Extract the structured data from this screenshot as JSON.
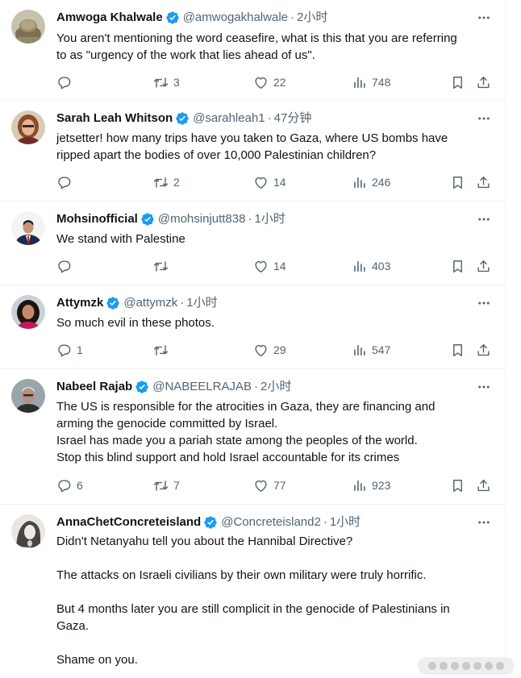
{
  "colors": {
    "text": "#0f1419",
    "muted": "#536471",
    "verified": "#1d9bf0",
    "border": "#eff3f4"
  },
  "icons": {
    "verified": "verified-badge-icon",
    "more": "more-horizontal-icon",
    "reply": "reply-icon",
    "retweet": "retweet-icon",
    "like": "heart-icon",
    "views": "views-chart-icon",
    "bookmark": "bookmark-icon",
    "share": "share-icon"
  },
  "tweets": [
    {
      "name": "Amwoga Khalwale",
      "handle": "@amwogakhalwale",
      "sep": "·",
      "time": "2小时",
      "lines": [
        "You aren't mentioning the word ceasefire, what is this that you are referring",
        "to as \"urgency of the work that lies ahead of us\"."
      ],
      "replies": "",
      "retweets": "3",
      "likes": "22",
      "views": "748"
    },
    {
      "name": "Sarah Leah Whitson",
      "handle": "@sarahleah1",
      "sep": "·",
      "time": "47分钟",
      "lines": [
        "jetsetter! how many trips have you taken to Gaza, where US bombs have",
        "ripped apart the bodies of over 10,000 Palestinian children?"
      ],
      "replies": "",
      "retweets": "2",
      "likes": "14",
      "views": "246"
    },
    {
      "name": "Mohsinofficial",
      "handle": "@mohsinjutt838",
      "sep": "·",
      "time": "1小时",
      "lines": [
        "We stand with Palestine"
      ],
      "replies": "",
      "retweets": "",
      "likes": "14",
      "views": "403"
    },
    {
      "name": "Attymzk",
      "handle": "@attymzk",
      "sep": "·",
      "time": "1小时",
      "lines": [
        "So much evil in these photos."
      ],
      "replies": "1",
      "retweets": "",
      "likes": "29",
      "views": "547"
    },
    {
      "name": "Nabeel Rajab",
      "handle": "@NABEELRAJAB",
      "sep": "·",
      "time": "2小时",
      "lines": [
        "The US is responsible for the atrocities in Gaza, they are financing and",
        "arming the genocide committed by Israel.",
        "Israel has made you a pariah state among the peoples of the world.",
        "Stop this blind support and hold Israel accountable for its crimes"
      ],
      "replies": "6",
      "retweets": "7",
      "likes": "77",
      "views": "923"
    },
    {
      "name": "AnnaChetConcreteisland",
      "handle": "@Concreteisland2",
      "sep": "·",
      "time": "1小时",
      "lines": [
        "Didn't Netanyahu tell you about the Hannibal Directive?",
        "",
        "The attacks on Israeli civilians by their own military were truly horrific.",
        "",
        "But 4 months later you are still complicit in the genocide of Palestinians in",
        "Gaza.",
        "",
        "Shame on you."
      ]
    }
  ]
}
